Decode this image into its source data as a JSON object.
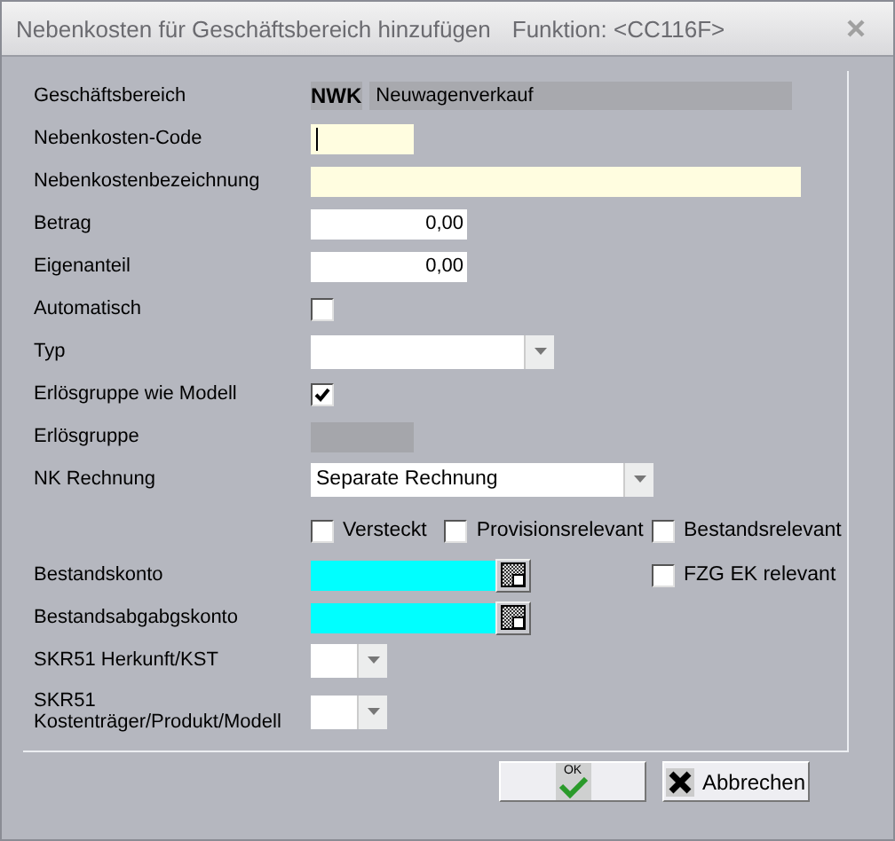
{
  "window": {
    "title": "Nebenkosten für Geschäftsbereich hinzufügen",
    "function": "Funktion: <CC116F>"
  },
  "fields": [
    {
      "kind": "display",
      "label": "Geschäftsbereich",
      "code": "NWK",
      "value": "Neuwagenverkauf"
    },
    {
      "kind": "text",
      "label": "Nebenkosten-Code",
      "required": true,
      "focused": true
    },
    {
      "kind": "text",
      "label": "Nebenkostenbezeichnung",
      "required": true,
      "focused": false
    },
    {
      "kind": "text",
      "label": "Betrag",
      "value": "0,00",
      "required": false,
      "focused": false
    },
    {
      "kind": "text",
      "label": "Eigenanteil",
      "value": "0,00",
      "required": false,
      "focused": false
    },
    {
      "kind": "checkbox",
      "label": "Automatisch",
      "checked": false
    },
    {
      "kind": "select",
      "label": "Typ"
    },
    {
      "kind": "checkbox",
      "label": "Erlösgruppe wie Modell",
      "checked": true
    },
    {
      "kind": "text",
      "label": "Erlösgruppe",
      "disabled": true,
      "required": false,
      "focused": false
    },
    {
      "kind": "select",
      "label": "NK Rechnung",
      "value": "Separate Rechnung"
    },
    {
      "kind": "flags",
      "items": [
        {
          "label": "Versteckt",
          "checked": false
        },
        {
          "label": "Provisionsrelevant",
          "checked": false
        }
      ],
      "side": {
        "label": "Bestandsrelevant",
        "checked": false
      }
    },
    {
      "kind": "account",
      "label": "Bestandskonto",
      "side": {
        "label": "FZG EK relevant",
        "checked": false
      }
    },
    {
      "kind": "account",
      "label": "Bestandsabgabgskonto"
    },
    {
      "kind": "select",
      "label": "SKR51 Herkunft/KST"
    },
    {
      "kind": "select",
      "label": "SKR51 Kostenträger/Produkt/Modell"
    }
  ],
  "buttons": {
    "ok": "OK",
    "cancel": "Abbrechen"
  }
}
